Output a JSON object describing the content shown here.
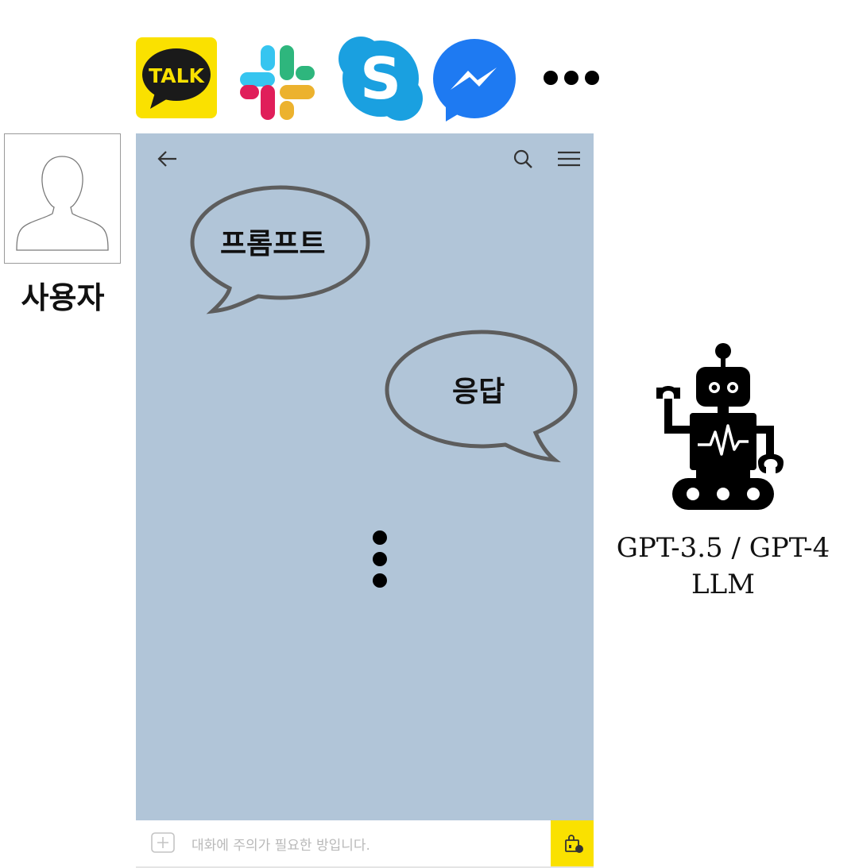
{
  "apps": {
    "kakao_label": "TALK",
    "kakao_color": "#fae100",
    "slack_colors": [
      "#36c5f0",
      "#2eb67d",
      "#ecb22e",
      "#e01e5a"
    ],
    "skype_color": "#1aa0e0",
    "messenger_color": "#1e7af2"
  },
  "user": {
    "label": "사용자"
  },
  "chat": {
    "background": "#b1c5d8",
    "prompt_bubble": "프롬프트",
    "response_bubble": "응답",
    "composer_placeholder": "대화에 주의가 필요한 방입니다.",
    "send_color": "#fae100"
  },
  "llm": {
    "model_label": "GPT-3.5 / GPT-4",
    "type_label": "LLM"
  }
}
